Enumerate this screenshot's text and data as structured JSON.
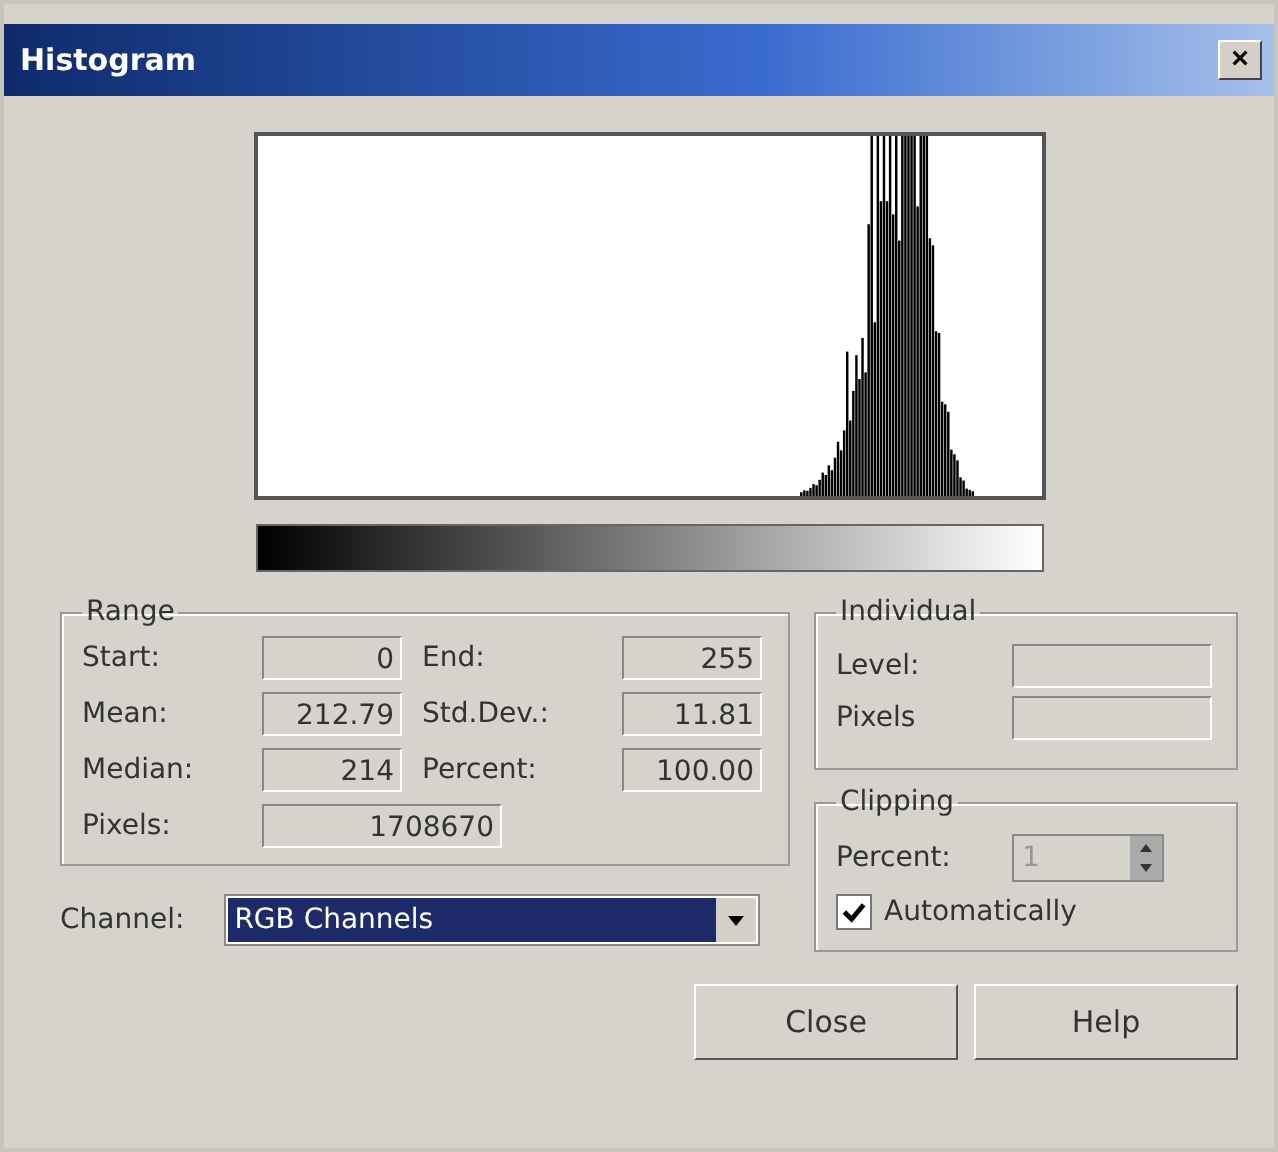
{
  "window": {
    "title": "Histogram",
    "close": "×"
  },
  "range": {
    "title": "Range",
    "fields": [
      {
        "label": "Start:",
        "value": "0"
      },
      {
        "label": "End:",
        "value": "255"
      },
      {
        "label": "Mean:",
        "value": "212.79"
      },
      {
        "label": "Std.Dev.:",
        "value": "11.81"
      },
      {
        "label": "Median:",
        "value": "214"
      },
      {
        "label": "Percent:",
        "value": "100.00"
      },
      {
        "label": "Pixels:",
        "value": "1708670"
      }
    ]
  },
  "individual": {
    "title": "Individual",
    "fields": [
      {
        "label": "Level:"
      },
      {
        "label": "Pixels"
      }
    ]
  },
  "clipping": {
    "title": "Clipping",
    "percent_label": "Percent:",
    "percent_value": "1",
    "percent_disabled": true,
    "auto_label": "Automatically",
    "auto_checked": true
  },
  "channel": {
    "label": "Channel:",
    "value": "RGB Channels"
  },
  "buttons": [
    "Close",
    "Help"
  ]
}
